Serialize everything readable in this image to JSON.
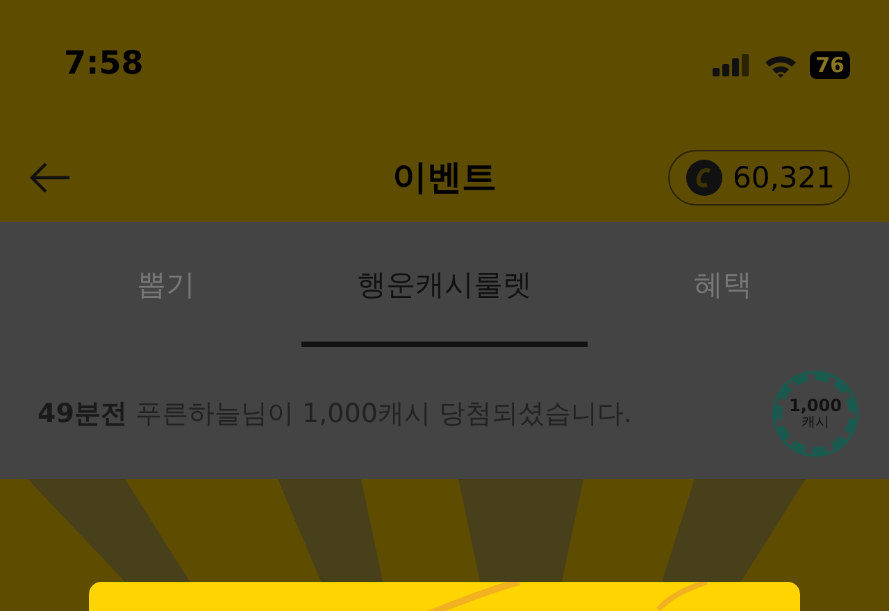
{
  "status_bar": {
    "time": "7:58",
    "battery": "76"
  },
  "header": {
    "title": "이벤트",
    "balance": "60,321"
  },
  "tabs": [
    {
      "label": "뽑기",
      "selected": false
    },
    {
      "label": "행운캐시룰렛",
      "selected": true
    },
    {
      "label": "혜택",
      "selected": false
    }
  ],
  "ticker": {
    "time": "49분전",
    "message": "푸른하늘님이 1,000캐시 당첨되셨습니다.",
    "chip_amount": "1,000",
    "chip_unit": "캐시"
  }
}
